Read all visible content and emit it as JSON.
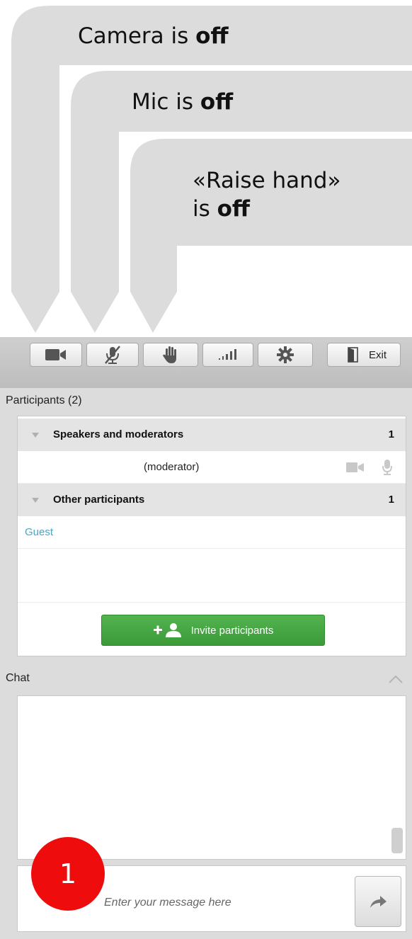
{
  "callouts": {
    "camera": {
      "prefix": "Camera is ",
      "state": "off"
    },
    "mic": {
      "prefix": "Mic is ",
      "state": "off"
    },
    "raise_hand": {
      "line1": "«Raise hand»",
      "prefix": "is ",
      "state": "off"
    }
  },
  "toolbar": {
    "buttons": [
      "camera-icon",
      "mic-muted-icon",
      "raise-hand-icon",
      "signal-icon",
      "gear-icon"
    ],
    "exit_label": "Exit"
  },
  "participants": {
    "header": "Participants (2)",
    "groups": [
      {
        "label": "Speakers and moderators",
        "count": "1",
        "members": [
          {
            "name": "(moderator)",
            "icons": [
              "camera-icon",
              "mic-icon"
            ]
          }
        ]
      },
      {
        "label": "Other participants",
        "count": "1",
        "members": [
          {
            "name": "Guest"
          }
        ]
      }
    ],
    "invite_label": "Invite participants"
  },
  "chat": {
    "header": "Chat",
    "placeholder": "Enter your message here"
  },
  "badge": {
    "label": "1"
  },
  "colors": {
    "accent_green": "#44a641",
    "guest_link": "#4aa6c5",
    "badge_red": "#ee0c0c"
  }
}
